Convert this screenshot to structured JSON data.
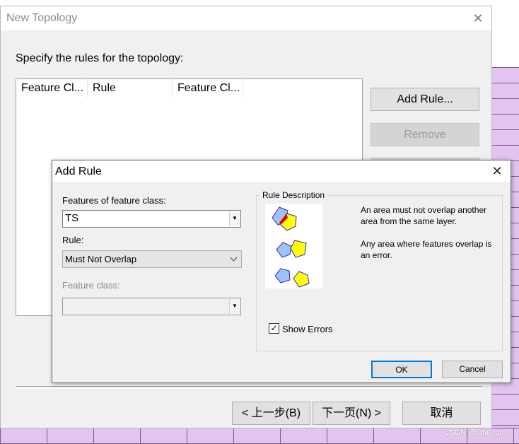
{
  "wizard": {
    "title": "New Topology",
    "prompt": "Specify the rules for the topology:",
    "columns": [
      "Feature Cl...",
      "Rule",
      "Feature Cl..."
    ],
    "add_rule_label": "Add Rule...",
    "remove_label": "Remove",
    "back_label": "< 上一步(B)",
    "next_label": "下一页(N) >",
    "cancel_label": "取消"
  },
  "dialog": {
    "title": "Add Rule",
    "features_label": "Features of feature class:",
    "features_value": "TS",
    "rule_label": "Rule:",
    "rule_value": "Must Not Overlap",
    "feature_class_label": "Feature class:",
    "feature_class_value": "",
    "rule_description_title": "Rule Description",
    "description_1": "An area must not overlap another area from the same layer.",
    "description_2": "Any area where features overlap is an error.",
    "show_errors_label": "Show Errors",
    "show_errors_checked": true,
    "ok_label": "OK",
    "cancel_label": "Cancel"
  },
  "colors": {
    "accent_focus": "#0078d7",
    "polygon_blue": "#9dc3f0",
    "polygon_yellow": "#ffff00",
    "error_red": "#e00000",
    "background_grid": "#e3c4ee"
  },
  "watermark": "CSDN @time_on"
}
